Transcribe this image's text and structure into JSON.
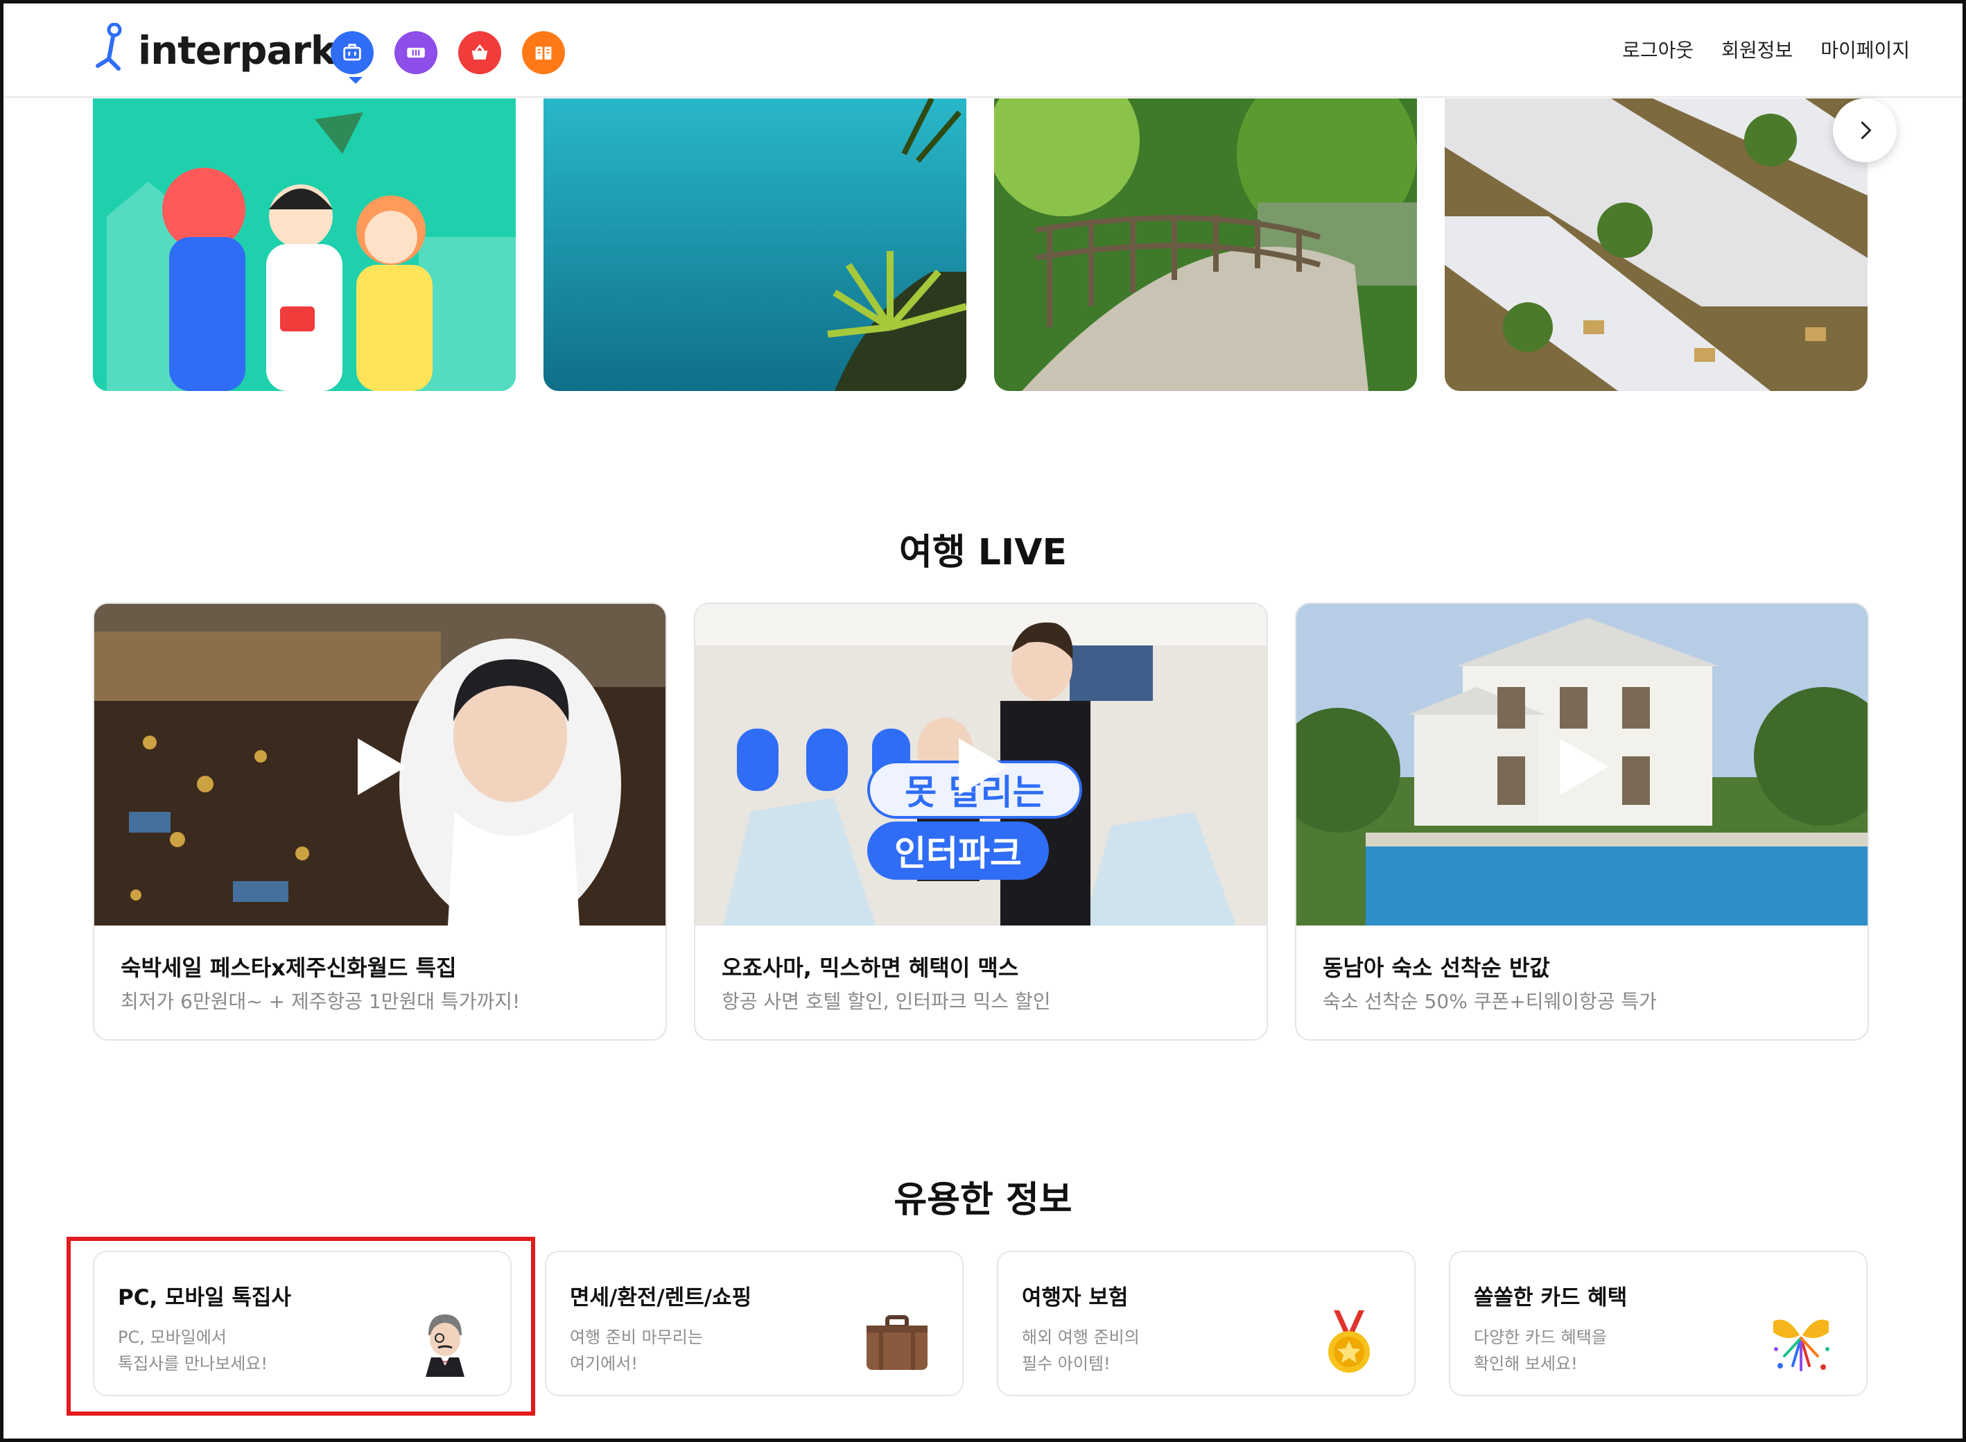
{
  "header": {
    "brand": "interpark",
    "services": [
      {
        "icon": "travel-bag-icon",
        "color": "#2f6df6"
      },
      {
        "icon": "ticket-icon",
        "color": "#8f4dea"
      },
      {
        "icon": "shopping-basket-icon",
        "color": "#f23b3b"
      },
      {
        "icon": "book-icon",
        "color": "#ff7a17"
      }
    ],
    "nav": [
      "로그아웃",
      "회원정보",
      "마이페이지"
    ]
  },
  "banners": [
    {
      "icon": "travelers-illustration"
    },
    {
      "icon": "ocean-palm-photo"
    },
    {
      "icon": "garden-bridge-photo"
    },
    {
      "icon": "market-tents-photo"
    }
  ],
  "live": {
    "title": "여행 LIVE",
    "cards": [
      {
        "title": "숙박세일 페스타x제주신화월드 특집",
        "subtitle": "최저가 6만원대~ + 제주항공 1만원대 특가까지!"
      },
      {
        "title": "오죠사마, 믹스하면 혜택이 맥스",
        "subtitle": "항공 사면 호텔 할인, 인터파크 믹스 할인",
        "overlay_top": "못 말리는",
        "overlay_bottom": "인터파크"
      },
      {
        "title": "동남아 숙소 선착순 반값",
        "subtitle": "숙소 선착순 50% 쿠폰+티웨이항공 특가"
      }
    ]
  },
  "info": {
    "title": "유용한 정보",
    "cards": [
      {
        "title": "PC, 모바일 톡집사",
        "desc1": "PC, 모바일에서",
        "desc2": "톡집사를 만나보세요!",
        "icon": "butler-icon"
      },
      {
        "title": "면세/환전/렌트/쇼핑",
        "desc1": "여행 준비 마무리는",
        "desc2": "여기에서!",
        "icon": "suitcase-icon"
      },
      {
        "title": "여행자 보험",
        "desc1": "해외 여행 준비의",
        "desc2": "필수 아이템!",
        "icon": "medal-icon"
      },
      {
        "title": "쏠쏠한 카드 혜택",
        "desc1": "다양한 카드 혜택을",
        "desc2": "확인해 보세요!",
        "icon": "confetti-icon"
      }
    ]
  },
  "colors": {
    "highlight": "#e21b1b",
    "brand_blue": "#2f6df6"
  }
}
